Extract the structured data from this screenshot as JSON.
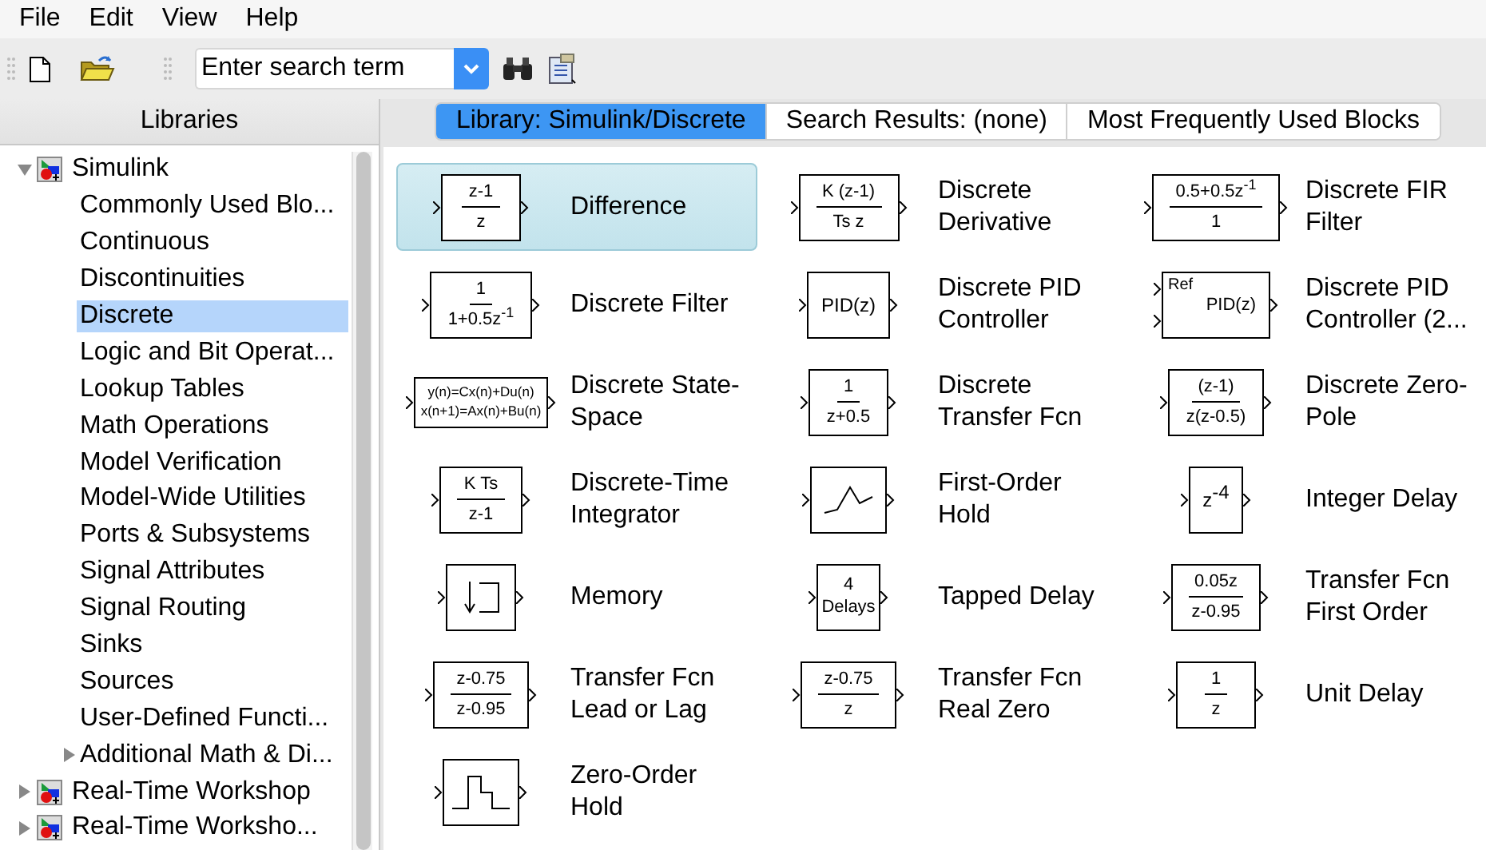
{
  "menu": [
    {
      "label": "File"
    },
    {
      "label": "Edit"
    },
    {
      "label": "View"
    },
    {
      "label": "Help"
    }
  ],
  "toolbar": {
    "search": {
      "value": "Enter search term"
    }
  },
  "libraries": {
    "title": "Libraries",
    "tree": [
      {
        "label": "Simulink",
        "expanded": true,
        "selected": false,
        "kind": "library",
        "children": [
          {
            "label": "Commonly Used Blo...",
            "selected": false
          },
          {
            "label": "Continuous",
            "selected": false
          },
          {
            "label": "Discontinuities",
            "selected": false
          },
          {
            "label": "Discrete",
            "selected": true
          },
          {
            "label": "Logic and Bit Operat...",
            "selected": false
          },
          {
            "label": "Lookup Tables",
            "selected": false
          },
          {
            "label": "Math Operations",
            "selected": false
          },
          {
            "label": "Model Verification",
            "selected": false
          },
          {
            "label": "Model-Wide Utilities",
            "selected": false
          },
          {
            "label": "Ports & Subsystems",
            "selected": false
          },
          {
            "label": "Signal Attributes",
            "selected": false
          },
          {
            "label": "Signal Routing",
            "selected": false
          },
          {
            "label": "Sinks",
            "selected": false
          },
          {
            "label": "Sources",
            "selected": false
          },
          {
            "label": "User-Defined Functi...",
            "selected": false
          },
          {
            "label": "Additional Math & Di...",
            "expanded": false,
            "selected": false
          }
        ]
      },
      {
        "label": "Real-Time Workshop",
        "expanded": false,
        "selected": false,
        "kind": "library"
      },
      {
        "label": "Real-Time Worksho...",
        "expanded": false,
        "selected": false,
        "kind": "library"
      }
    ]
  },
  "tabs": [
    {
      "label": "Library: Simulink/Discrete",
      "selected": true
    },
    {
      "label": "Search Results: (none)",
      "selected": false
    },
    {
      "label": "Most Frequently Used Blocks",
      "selected": false
    }
  ],
  "blocks": [
    {
      "label": "Difference",
      "selected": true,
      "kind": "fraction",
      "numerator": "z-1",
      "denominator": "z"
    },
    {
      "label": "Discrete Derivative",
      "selected": false,
      "kind": "fraction",
      "numerator": "K (z-1)",
      "denominator": "Ts z"
    },
    {
      "label": "Discrete FIR Filter",
      "selected": false,
      "kind": "fraction",
      "numerator": "0.5+0.5z$^{-1}$",
      "denominator": "1"
    },
    {
      "label": "Discrete Filter",
      "selected": false,
      "kind": "fraction",
      "numerator": "1",
      "denominator": "1+0.5z$^{-1}$"
    },
    {
      "label": "Discrete PID Controller",
      "selected": false,
      "kind": "text",
      "text": "PID(z)"
    },
    {
      "label": "Discrete PID Controller (2...",
      "selected": false,
      "kind": "ref",
      "port_label": "Ref",
      "text": "PID(z)"
    },
    {
      "label": "Discrete State-Space",
      "selected": false,
      "kind": "lines",
      "lines": [
        "y(n)=Cx(n)+Du(n)",
        "x(n+1)=Ax(n)+Bu(n)"
      ]
    },
    {
      "label": "Discrete Transfer Fcn",
      "selected": false,
      "kind": "fraction",
      "numerator": "1",
      "denominator": "z+0.5"
    },
    {
      "label": "Discrete Zero-Pole",
      "selected": false,
      "kind": "fraction",
      "numerator": "(z-1)",
      "denominator": "z(z-0.5)"
    },
    {
      "label": "Discrete-Time Integrator",
      "selected": false,
      "kind": "fraction",
      "numerator": "K Ts",
      "denominator": "z-1"
    },
    {
      "label": "First-Order Hold",
      "selected": false,
      "kind": "first-order-hold"
    },
    {
      "label": "Integer Delay",
      "selected": false,
      "kind": "text",
      "text": "z$^{-4}$"
    },
    {
      "label": "Memory",
      "selected": false,
      "kind": "memory"
    },
    {
      "label": "Tapped Delay",
      "selected": false,
      "kind": "lines",
      "lines": [
        "4",
        "Delays"
      ]
    },
    {
      "label": "Transfer Fcn First Order",
      "selected": false,
      "kind": "fraction",
      "numerator": "0.05z",
      "denominator": "z-0.95"
    },
    {
      "label": "Transfer Fcn Lead or Lag",
      "selected": false,
      "kind": "fraction",
      "numerator": "z-0.75",
      "denominator": "z-0.95"
    },
    {
      "label": "Transfer Fcn Real Zero",
      "selected": false,
      "kind": "fraction",
      "numerator": "z-0.75",
      "denominator": "z"
    },
    {
      "label": "Unit Delay",
      "selected": false,
      "kind": "fraction",
      "numerator": "1",
      "denominator": "z"
    },
    {
      "label": "Zero-Order Hold",
      "selected": false,
      "kind": "zero-order-hold"
    }
  ]
}
